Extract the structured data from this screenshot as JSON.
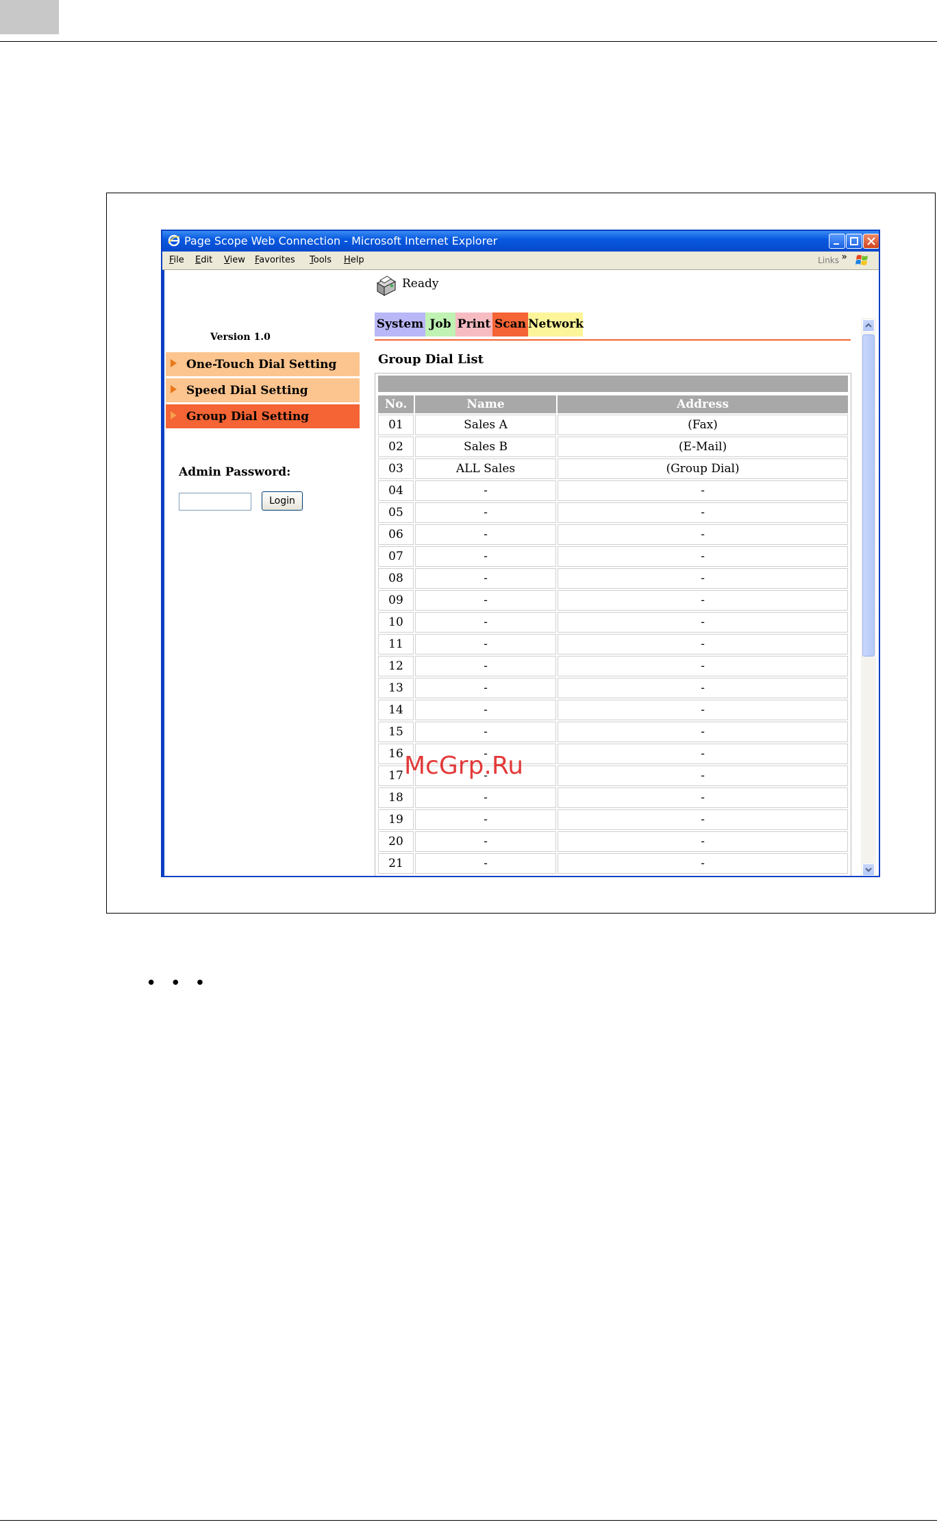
{
  "window": {
    "title": "Page Scope Web Connection - Microsoft Internet Explorer"
  },
  "menubar": {
    "items": [
      "File",
      "Edit",
      "View",
      "Favorites",
      "Tools",
      "Help"
    ],
    "links_label": "Links",
    "chevron": "»"
  },
  "left_panel": {
    "version": "Version 1.0",
    "nav_items": [
      "One-Touch Dial Setting",
      "Speed Dial Setting",
      "Group Dial Setting"
    ],
    "active_nav": "Group Dial Setting",
    "admin_label": "Admin Password:",
    "password_value": "",
    "login_label": "Login"
  },
  "status": {
    "text": "Ready"
  },
  "tabs": [
    "System",
    "Job",
    "Print",
    "Scan",
    "Network"
  ],
  "active_tab": "Scan",
  "list": {
    "title": "Group Dial List",
    "columns": [
      "No.",
      "Name",
      "Address"
    ],
    "rows": [
      [
        "01",
        "Sales A",
        "(Fax)"
      ],
      [
        "02",
        "Sales B",
        "(E-Mail)"
      ],
      [
        "03",
        "ALL Sales",
        "(Group Dial)"
      ],
      [
        "04",
        "-",
        "-"
      ],
      [
        "05",
        "-",
        "-"
      ],
      [
        "06",
        "-",
        "-"
      ],
      [
        "07",
        "-",
        "-"
      ],
      [
        "08",
        "-",
        "-"
      ],
      [
        "09",
        "-",
        "-"
      ],
      [
        "10",
        "-",
        "-"
      ],
      [
        "11",
        "-",
        "-"
      ],
      [
        "12",
        "-",
        "-"
      ],
      [
        "13",
        "-",
        "-"
      ],
      [
        "14",
        "-",
        "-"
      ],
      [
        "15",
        "-",
        "-"
      ],
      [
        "16",
        "-",
        "-"
      ],
      [
        "17",
        "-",
        "-"
      ],
      [
        "18",
        "-",
        "-"
      ],
      [
        "19",
        "-",
        "-"
      ],
      [
        "20",
        "-",
        "-"
      ],
      [
        "21",
        "-",
        "-"
      ]
    ]
  },
  "watermark": "McGrp.Ru",
  "page_dots": "• • •",
  "colors": {
    "titlebar": "#0859e0",
    "nav_item": "#fcc48e",
    "nav_active": "#f46434",
    "tab_system": "#b9b7f7",
    "tab_job": "#bff2b3",
    "tab_print": "#f6bcc2",
    "tab_scan": "#f46434",
    "tab_network": "#fcf59a",
    "table_header": "#a8a8a8"
  },
  "icons": {
    "browser": "ie-logo-icon",
    "status": "printer-icon",
    "windows": "windows-flag-icon"
  }
}
